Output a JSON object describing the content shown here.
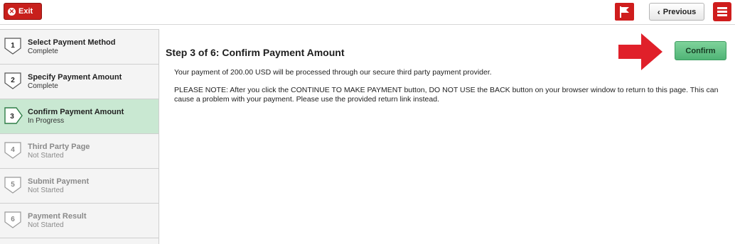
{
  "topbar": {
    "exit_label": "Exit",
    "previous_label": "Previous"
  },
  "steps": [
    {
      "number": "1",
      "title": "Select Payment Method",
      "status": "Complete"
    },
    {
      "number": "2",
      "title": "Specify Payment Amount",
      "status": "Complete"
    },
    {
      "number": "3",
      "title": "Confirm Payment Amount",
      "status": "In Progress"
    },
    {
      "number": "4",
      "title": "Third Party Page",
      "status": "Not Started"
    },
    {
      "number": "5",
      "title": "Submit Payment",
      "status": "Not Started"
    },
    {
      "number": "6",
      "title": "Payment Result",
      "status": "Not Started"
    }
  ],
  "main": {
    "heading": "Step 3 of 6: Confirm Payment Amount",
    "paragraph1": "Your payment of 200.00 USD will be processed through our secure third party payment provider.",
    "paragraph2": "PLEASE NOTE:  After you click the CONTINUE TO MAKE PAYMENT button, DO NOT USE the BACK button on your browser window to return to this page.  This can cause a problem with your payment.  Please use the provided return link instead.",
    "confirm_label": "Confirm"
  },
  "colors": {
    "brand_red": "#cf1d1d",
    "active_step": "#c9e8d2",
    "confirm_green": "#5cbd80",
    "arrow_red": "#e0202a"
  },
  "icons": [
    "close-icon",
    "flag-icon",
    "chevron-left-icon",
    "hamburger-menu-icon",
    "step-badge-icon",
    "arrow-right-icon"
  ]
}
